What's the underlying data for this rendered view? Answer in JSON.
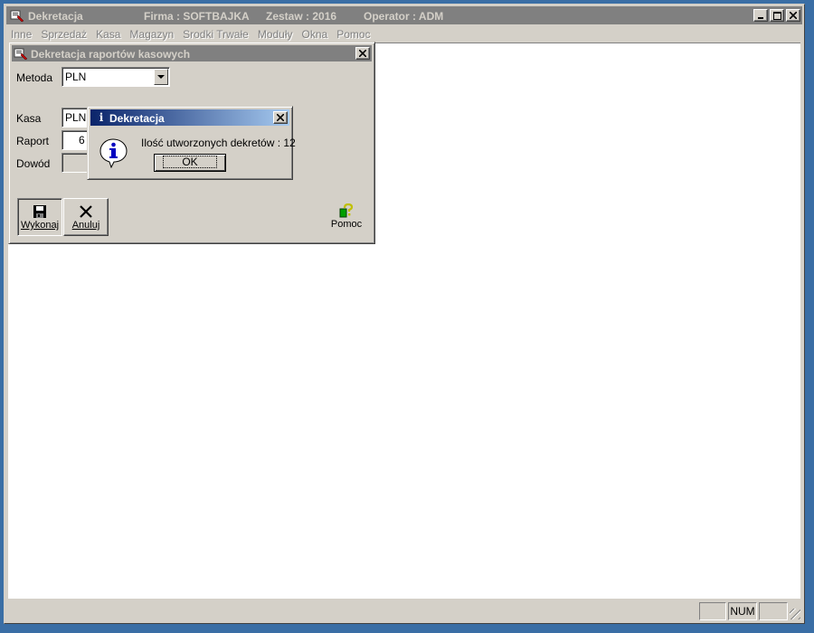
{
  "window": {
    "title": "Dekretacja",
    "firma": "Firma : SOFTBAJKA",
    "zestaw": "Zestaw : 2016",
    "operator": "Operator : ADM"
  },
  "menu": [
    "Inne",
    "Sprzedaż",
    "Kasa",
    "Magazyn",
    "Srodki Trwałe",
    "Moduły",
    "Okna",
    "Pomoc"
  ],
  "child_window": {
    "title": "Dekretacja raportów kasowych",
    "metoda_label": "Metoda",
    "metoda_value": "PLN",
    "kasa_label": "Kasa",
    "kasa_value": "PLN",
    "raport_label": "Raport",
    "raport_value": "6",
    "dowod_label": "Dowód",
    "dowod_value": "",
    "toolbar": {
      "wykonaj": "Wykonaj",
      "anuluj": "Anuluj",
      "pomoc": "Pomoc"
    }
  },
  "dialog": {
    "title": "Dekretacja",
    "message": "Ilość utworzonych dekretów : 12",
    "ok_label": "OK"
  },
  "status_bar": {
    "num": "NUM"
  }
}
